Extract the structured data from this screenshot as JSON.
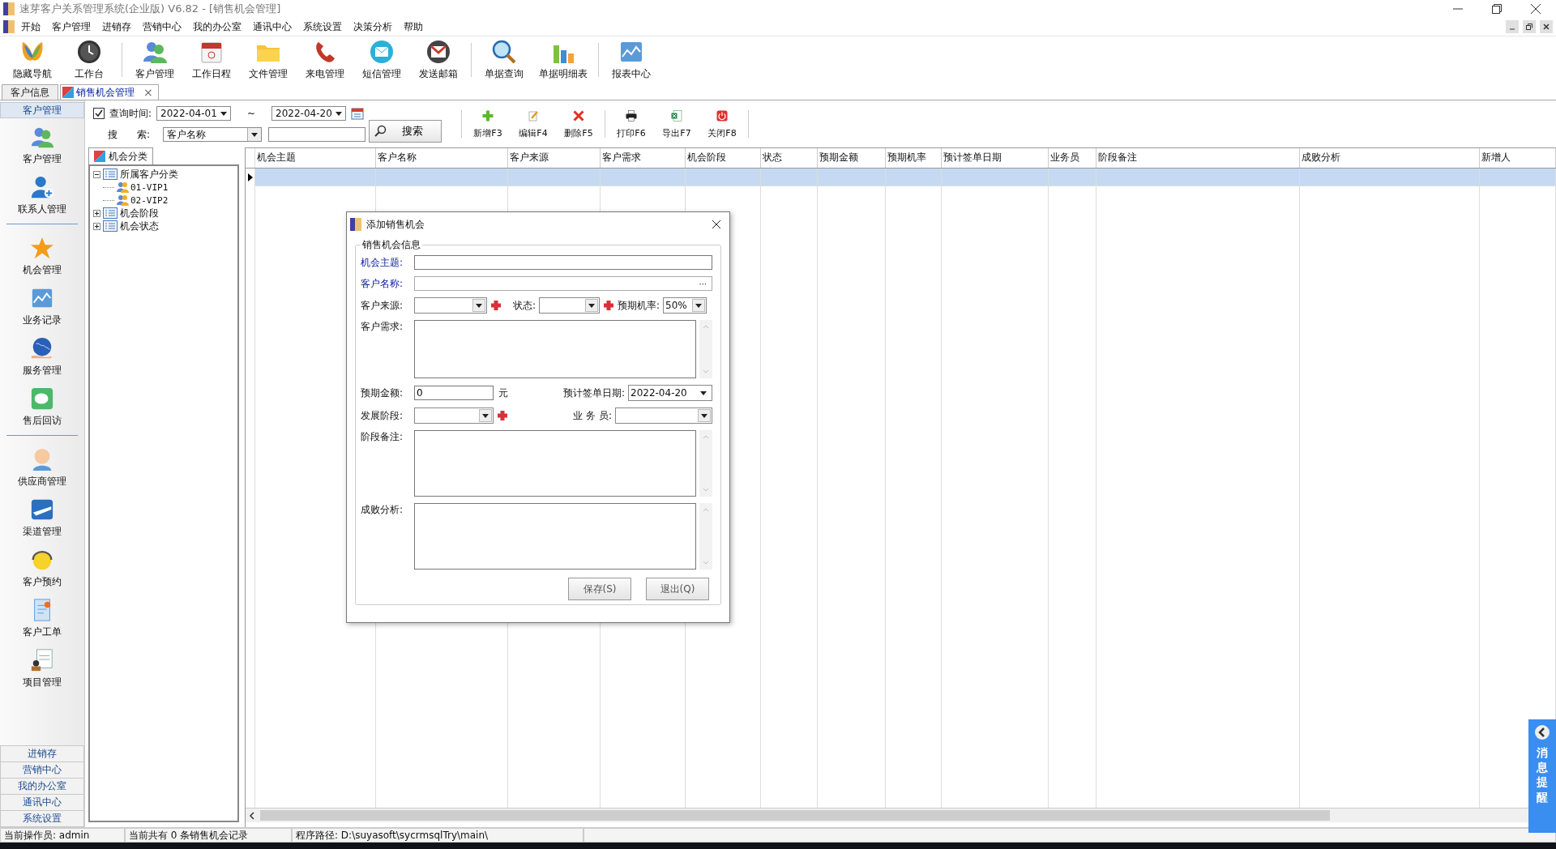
{
  "window": {
    "title": "速芽客户关系管理系统(企业版) V6.82 - [销售机会管理]"
  },
  "menu": [
    "开始",
    "客户管理",
    "进销存",
    "营销中心",
    "我的办公室",
    "通讯中心",
    "系统设置",
    "决策分析",
    "帮助"
  ],
  "toolbar": [
    {
      "items": [
        "隐藏导航",
        "工作台"
      ]
    },
    {
      "items": [
        "客户管理",
        "工作日程",
        "文件管理",
        "来电管理",
        "短信管理",
        "发送邮箱"
      ]
    },
    {
      "items": [
        "单据查询",
        "单据明细表"
      ]
    },
    {
      "items": [
        "报表中心"
      ]
    }
  ],
  "tabs": [
    {
      "label": "客户信息",
      "selected": false
    },
    {
      "label": "销售机会管理",
      "selected": true,
      "close": "×"
    }
  ],
  "sidebar": {
    "header": "客户管理",
    "groups": [
      {
        "items": [
          "客户管理",
          "联系人管理"
        ]
      },
      {
        "items": [
          "机会管理",
          "业务记录",
          "服务管理",
          "售后回访"
        ]
      },
      {
        "items": [
          "供应商管理",
          "渠道管理",
          "客户预约",
          "客户工单",
          "项目管理"
        ]
      }
    ],
    "sections": [
      "进销存",
      "营销中心",
      "我的办公室",
      "通讯中心",
      "系统设置"
    ]
  },
  "filter": {
    "query_time": {
      "checked": true,
      "label": "查询时间:"
    },
    "date_from": "2022-04-01",
    "separator": "~",
    "date_to": "2022-04-20",
    "search_label": "搜　　索:",
    "search_field": "客户名称",
    "search_button": "搜索"
  },
  "actions": [
    {
      "items": [
        "新增F3",
        "编辑F4",
        "删除F5"
      ]
    },
    {
      "items": [
        "打印F6",
        "导出F7",
        "关闭F8"
      ]
    }
  ],
  "tree": {
    "tab": "机会分类",
    "nodes": [
      {
        "label": "所属客户分类",
        "expanded": true,
        "children": [
          {
            "label": "01-VIP1"
          },
          {
            "label": "02-VIP2"
          }
        ]
      },
      {
        "label": "机会阶段",
        "expanded": false
      },
      {
        "label": "机会状态",
        "expanded": false
      }
    ]
  },
  "grid": {
    "columns": [
      "机会主题",
      "客户名称",
      "客户来源",
      "客户需求",
      "机会阶段",
      "状态",
      "预期金额",
      "预期机率",
      "预计签单日期",
      "业务员",
      "阶段备注",
      "成败分析",
      "新增人"
    ],
    "rows": [
      {
        "selected": true
      }
    ]
  },
  "dialog": {
    "title": "添加销售机会",
    "group": "销售机会信息",
    "subject": {
      "label": "机会主题:",
      "required": true
    },
    "customer": {
      "label": "客户名称:",
      "required": true,
      "button": "···"
    },
    "source": {
      "label": "客户来源:"
    },
    "status": {
      "label": "状态:"
    },
    "probability": {
      "label": "预期机率:",
      "value": "50%"
    },
    "needs": {
      "label": "客户需求:"
    },
    "amount": {
      "label": "预期金额:",
      "value": "0",
      "unit": "元"
    },
    "sign_date": {
      "label": "预计签单日期:",
      "value": "2022-04-20"
    },
    "stage": {
      "label": "发展阶段:"
    },
    "salesperson": {
      "label": "业 务 员:"
    },
    "stage_note": {
      "label": "阶段备注:"
    },
    "analysis": {
      "label": "成败分析:"
    },
    "buttons": [
      "保存(S)",
      "退出(Q)"
    ]
  },
  "notice": {
    "label": "消息提醒"
  },
  "status_bar": [
    "当前操作员: admin",
    "当前共有 0 条销售机会记录",
    "程序路径: D:\\suyasoft\\sycrmsqlTry\\main\\"
  ]
}
